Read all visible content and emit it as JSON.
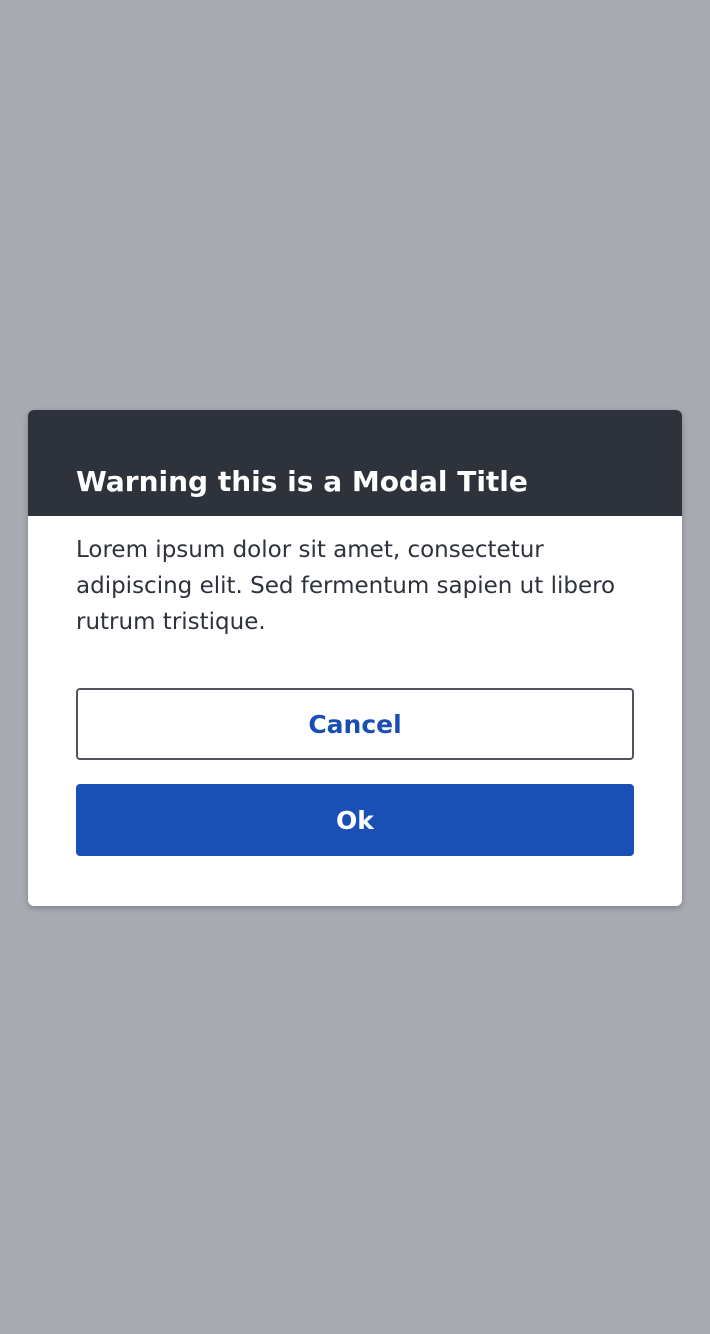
{
  "modal": {
    "title": "Warning this is a Modal Title",
    "body": "Lorem ipsum dolor sit amet, consectetur adipiscing elit. Sed fermentum sapien ut libero rutrum tristique.",
    "cancel_label": "Cancel",
    "ok_label": "Ok"
  },
  "colors": {
    "backdrop": "#a7aab1",
    "header_bg": "#2e323b",
    "primary": "#1a4fb6",
    "text": "#2e323b"
  }
}
